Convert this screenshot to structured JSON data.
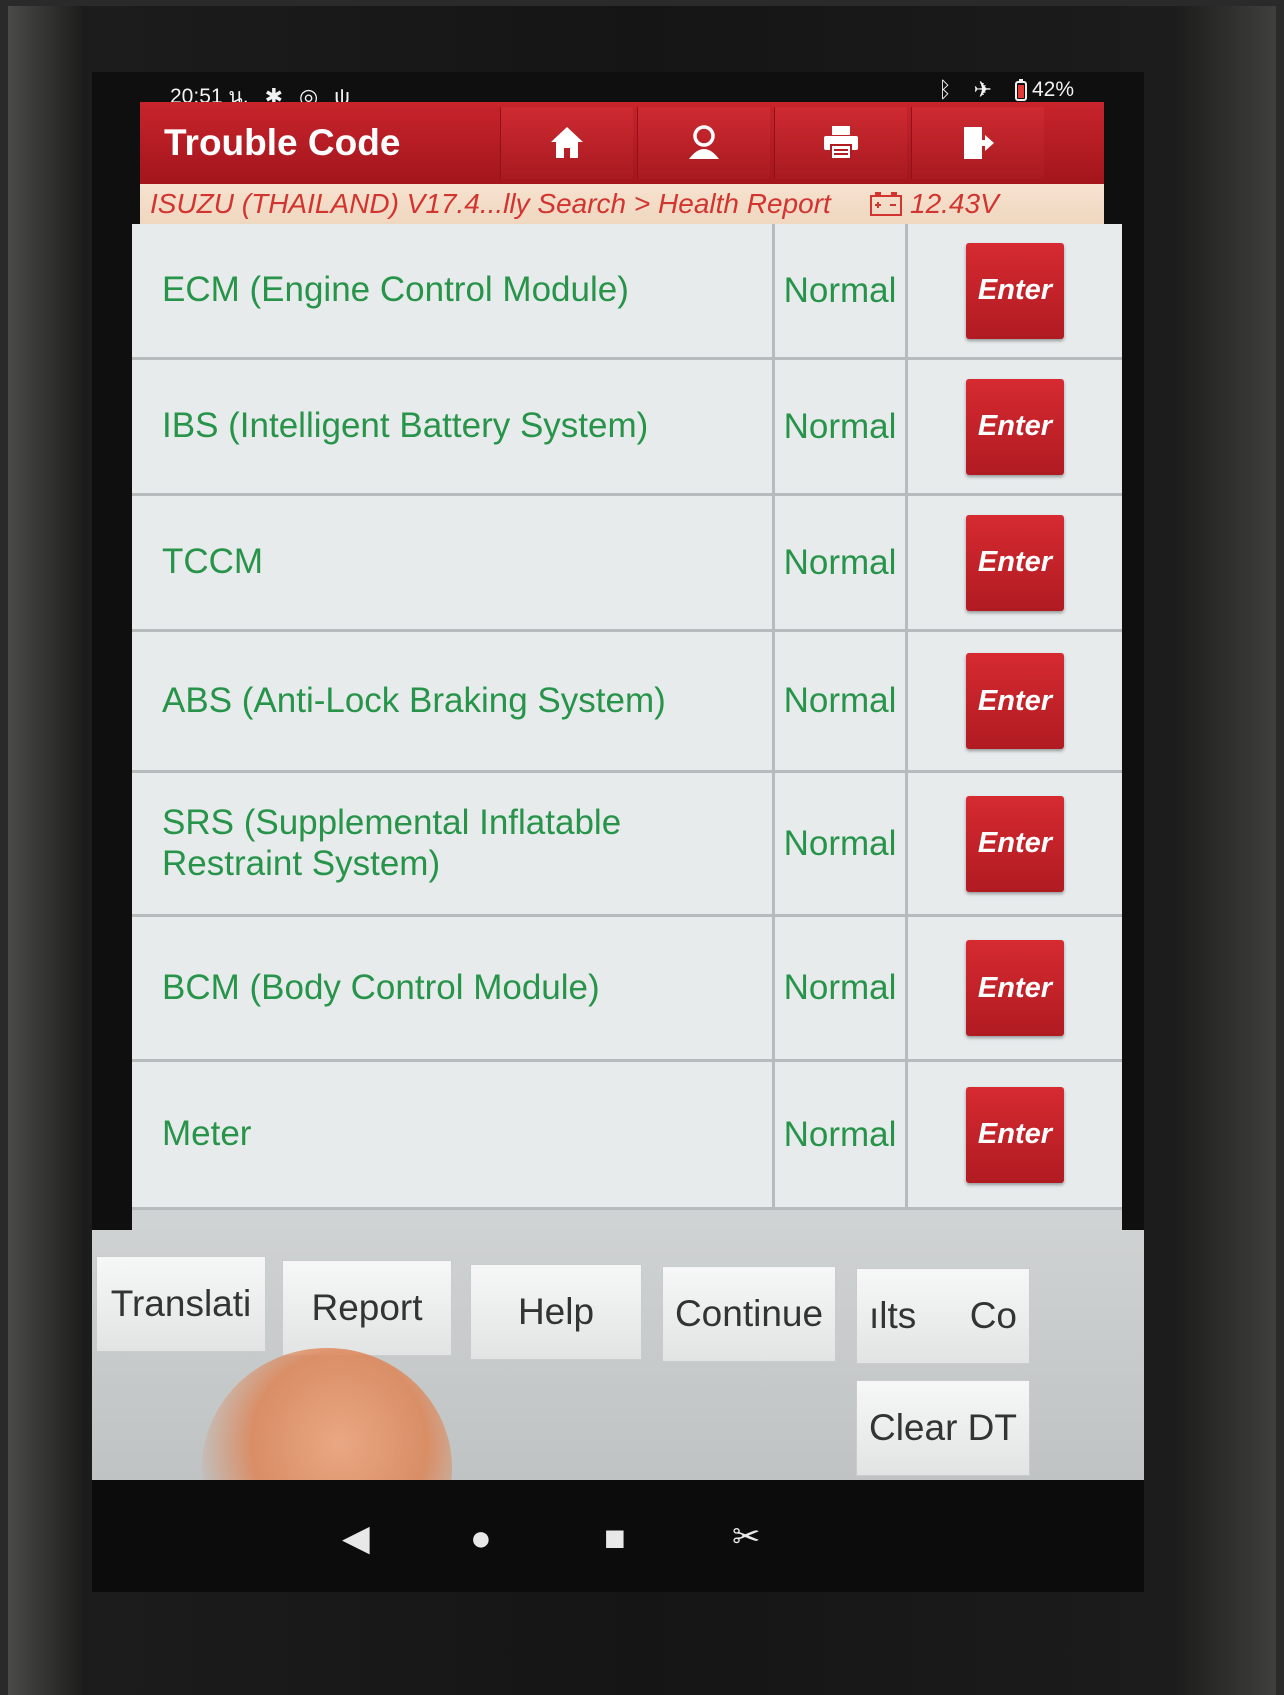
{
  "status_bar": {
    "time": "20:51 น.",
    "battery_percent": "42%",
    "icons": [
      "settings-icon",
      "clock-icon",
      "stethoscope-icon",
      "bluetooth-icon",
      "airplane-mode-icon",
      "battery-icon"
    ]
  },
  "header": {
    "title": "Trouble Code",
    "buttons": [
      "home-icon",
      "user-icon",
      "print-icon",
      "exit-icon"
    ]
  },
  "breadcrumb": {
    "path": "ISUZU (THAILAND) V17.4...lly Search > Health Report",
    "voltage": "12.43V"
  },
  "modules": [
    {
      "name": "ECM (Engine Control Module)",
      "status": "Normal",
      "action": "Enter"
    },
    {
      "name": "IBS (Intelligent Battery System)",
      "status": "Normal",
      "action": "Enter"
    },
    {
      "name": "TCCM",
      "status": "Normal",
      "action": "Enter"
    },
    {
      "name": "ABS (Anti-Lock Braking System)",
      "status": "Normal",
      "action": "Enter"
    },
    {
      "name": "SRS (Supplemental Inflatable Restraint System)",
      "status": "Normal",
      "action": "Enter"
    },
    {
      "name": "BCM (Body Control Module)",
      "status": "Normal",
      "action": "Enter"
    },
    {
      "name": "Meter",
      "status": "Normal",
      "action": "Enter"
    }
  ],
  "actions": {
    "translate": "Translati",
    "report": "Report",
    "help": "Help",
    "continue": "Continue",
    "results": "ılts",
    "co": "Co",
    "clear_dtc": "Clear DT"
  },
  "colors": {
    "header_red": "#b71c22",
    "status_green": "#27944a",
    "crumb_text": "#d2352f"
  }
}
